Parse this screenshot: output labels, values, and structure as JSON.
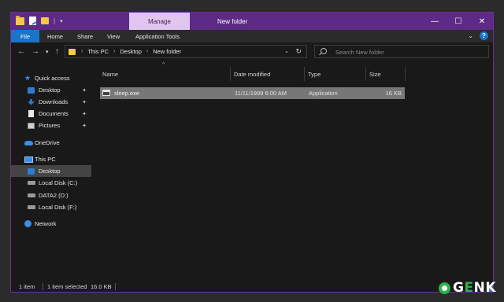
{
  "titlebar": {
    "manage_tab": "Manage",
    "title": "New folder",
    "minimize": "—",
    "maximize": "☐",
    "close": "✕"
  },
  "ribbon": {
    "tabs": [
      "File",
      "Home",
      "Share",
      "View",
      "Application Tools"
    ],
    "chevron": "⌄",
    "help": "?"
  },
  "address": {
    "crumbs": [
      "This PC",
      "Desktop",
      "New folder"
    ],
    "search_placeholder": "Search New folder"
  },
  "nav": {
    "quick_access": "Quick access",
    "desktop_pinned": "Desktop",
    "downloads": "Downloads",
    "documents": "Documents",
    "pictures": "Pictures",
    "onedrive": "OneDrive",
    "this_pc": "This PC",
    "desktop_selected": "Desktop",
    "local_c": "Local Disk (C:)",
    "data2_d": "DATA2 (D:)",
    "local_f": "Local Disk (F:)",
    "network": "Network"
  },
  "columns": {
    "name": "Name",
    "date_modified": "Date modified",
    "type": "Type",
    "size": "Size"
  },
  "files": [
    {
      "name": "sleep.exe",
      "date": "11/11/1999 6:00 AM",
      "type": "Application",
      "size": "16 KB"
    }
  ],
  "status": {
    "count": "1 item",
    "selected": "1 item selected",
    "size": "16.0 KB"
  },
  "watermark": {
    "brand_g": "G",
    "brand_e": "E",
    "brand_nk": "NK"
  },
  "colors": {
    "titlebar": "#5d2a86",
    "manage_tab": "#e0c6ee",
    "accent": "#1a74c9",
    "selected_row": "#777777"
  }
}
